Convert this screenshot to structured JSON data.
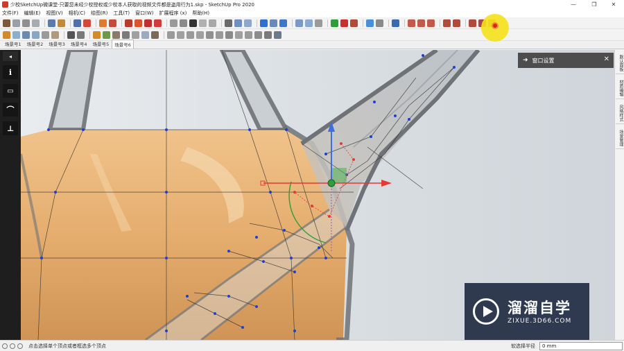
{
  "window": {
    "title": "少校SketchUp微课堂-只要您未经少校授权或少校本人获取的视频文件都是盗用行为1.skp - SketchUp Pro 2020",
    "minimize": "—",
    "maximize": "❐",
    "close": "✕"
  },
  "menu": [
    "文件(F)",
    "编辑(E)",
    "视图(V)",
    "相机(C)",
    "绘图(R)",
    "工具(T)",
    "窗口(W)",
    "扩展程序 (x)",
    "帮助(H)"
  ],
  "scene_tabs": [
    "场景号1",
    "场景号2",
    "场景号3",
    "场景号4",
    "场景号5",
    "场景号6"
  ],
  "active_scene": "场景号6",
  "left_tools": [
    {
      "name": "entity-info-icon",
      "glyph": "i"
    },
    {
      "name": "rectangle-icon",
      "glyph": "▭"
    },
    {
      "name": "arc-tool-icon",
      "glyph": "⌒"
    },
    {
      "name": "axes-icon",
      "glyph": "⊥"
    }
  ],
  "tray": {
    "title": "窗口设置",
    "arrow": "➜",
    "close": "✕",
    "side_tabs": [
      "默认面板",
      "材质编辑",
      "风格样式",
      "场景管理"
    ]
  },
  "status": {
    "hint": "点击选择单个顶点或者框选多个顶点",
    "measure_label": "软选择半径",
    "measure_value": "0 mm"
  },
  "watermark": {
    "name": "溜溜自学",
    "url": "ZIXUE.3D66.COM"
  },
  "colors": {
    "viewport_bg": "#dfe3e6",
    "liquid": "#e8b273",
    "glass_edge": "#6f7378",
    "vertex": "#1f3fd0",
    "axis_red": "#e53935",
    "axis_blue": "#3d6fe0",
    "axis_green": "#2f9d3a",
    "tray_header": "#4d4d4d",
    "watermark_bg": "#232e45"
  }
}
